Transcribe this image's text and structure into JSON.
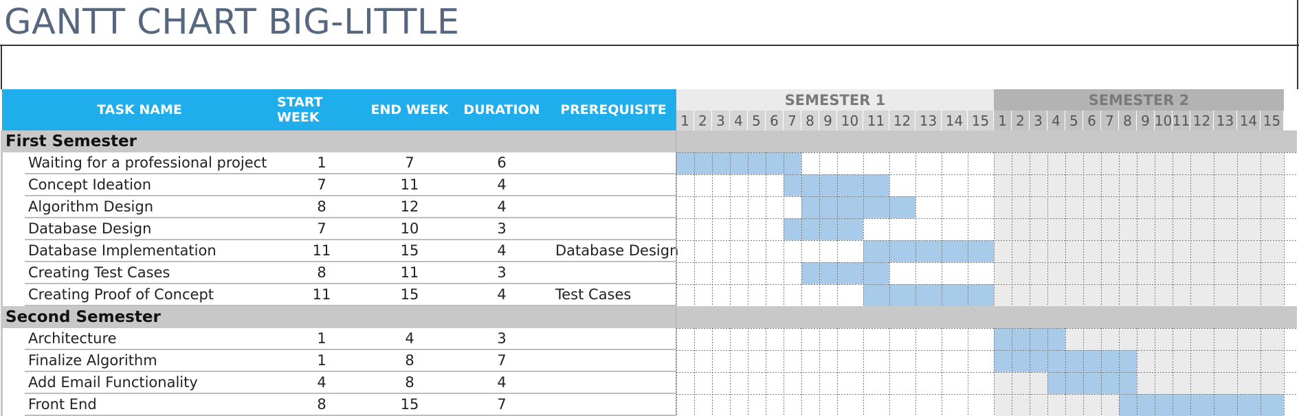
{
  "title": "GANTT CHART BIG-LITTLE",
  "columns": {
    "task_name": "TASK NAME",
    "start_week": "START WEEK",
    "end_week": "END WEEK",
    "duration": "DURATION",
    "prerequisite": "PREREQUISITE"
  },
  "semesters": [
    {
      "label": "SEMESTER 1",
      "weeks": [
        "1",
        "2",
        "3",
        "4",
        "5",
        "6",
        "7",
        "8",
        "9",
        "10",
        "11",
        "12",
        "13",
        "14",
        "15"
      ]
    },
    {
      "label": "SEMESTER 2",
      "weeks": [
        "1",
        "2",
        "3",
        "4",
        "5",
        "6",
        "7",
        "8",
        "9",
        "10",
        "11",
        "12",
        "13",
        "14",
        "15"
      ]
    }
  ],
  "groups": [
    {
      "name": "First Semester",
      "semester_index": 0,
      "tasks": [
        {
          "name": "Waiting for a professional project",
          "start": "1",
          "end": "7",
          "duration": "6",
          "prerequisite": ""
        },
        {
          "name": "Concept Ideation",
          "start": "7",
          "end": "11",
          "duration": "4",
          "prerequisite": ""
        },
        {
          "name": "Algorithm Design",
          "start": "8",
          "end": "12",
          "duration": "4",
          "prerequisite": ""
        },
        {
          "name": "Database Design",
          "start": "7",
          "end": "10",
          "duration": "3",
          "prerequisite": ""
        },
        {
          "name": "Database Implementation",
          "start": "11",
          "end": "15",
          "duration": "4",
          "prerequisite": "Database Design"
        },
        {
          "name": "Creating Test Cases",
          "start": "8",
          "end": "11",
          "duration": "3",
          "prerequisite": ""
        },
        {
          "name": "Creating Proof of Concept",
          "start": "11",
          "end": "15",
          "duration": "4",
          "prerequisite": "Test Cases"
        }
      ]
    },
    {
      "name": "Second Semester",
      "semester_index": 1,
      "tasks": [
        {
          "name": "Architecture",
          "start": "1",
          "end": "4",
          "duration": "3",
          "prerequisite": ""
        },
        {
          "name": "Finalize Algorithm",
          "start": "1",
          "end": "8",
          "duration": "7",
          "prerequisite": ""
        },
        {
          "name": "Add Email Functionality",
          "start": "4",
          "end": "8",
          "duration": "4",
          "prerequisite": ""
        },
        {
          "name": "Front End",
          "start": "8",
          "end": "15",
          "duration": "7",
          "prerequisite": ""
        }
      ]
    }
  ],
  "colors": {
    "header_blue": "#1fadeb",
    "bar_blue": "#a9cbea",
    "sem1_header_bg": "#ebebeb",
    "sem2_header_bg": "#b3b3b3",
    "sem1_week_bg": "#d6d6d6",
    "sem2_week_bg": "#c3c3c3",
    "sem2_grid_bg": "#ebebeb",
    "group_row_bg": "#c8c8c8"
  }
}
